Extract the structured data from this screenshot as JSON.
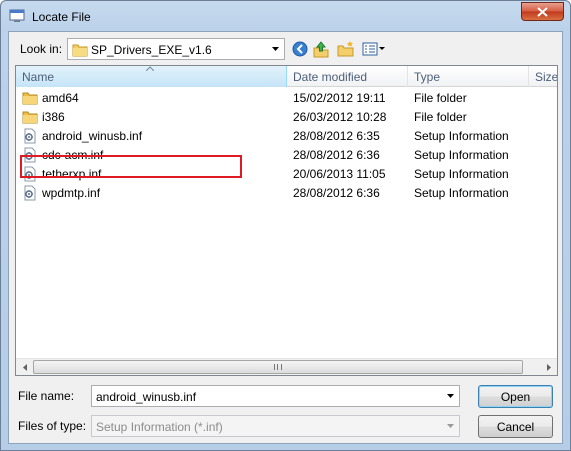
{
  "window": {
    "title": "Locate File"
  },
  "lookin": {
    "label": "Look in:",
    "value": "SP_Drivers_EXE_v1.6"
  },
  "columns": {
    "name": "Name",
    "date": "Date modified",
    "type": "Type",
    "size": "Size"
  },
  "files": [
    {
      "name": "amd64",
      "date": "15/02/2012 19:11",
      "type": "File folder",
      "icon": "folder-icon"
    },
    {
      "name": "i386",
      "date": "26/03/2012 10:28",
      "type": "File folder",
      "icon": "folder-icon"
    },
    {
      "name": "android_winusb.inf",
      "date": "28/08/2012 6:35",
      "type": "Setup Information",
      "icon": "setup-file-icon"
    },
    {
      "name": "cdc-acm.inf",
      "date": "28/08/2012 6:36",
      "type": "Setup Information",
      "icon": "setup-file-icon"
    },
    {
      "name": "tetherxp.inf",
      "date": "20/06/2013 11:05",
      "type": "Setup Information",
      "icon": "setup-file-icon"
    },
    {
      "name": "wpdmtp.inf",
      "date": "28/08/2012 6:36",
      "type": "Setup Information",
      "icon": "setup-file-icon"
    }
  ],
  "filename": {
    "label": "File name:",
    "value": "android_winusb.inf"
  },
  "filetype": {
    "label": "Files of type:",
    "value": "Setup Information (*.inf)"
  },
  "buttons": {
    "open": "Open",
    "cancel": "Cancel"
  },
  "colors": {
    "highlight": "#e01a22",
    "accent": "#3c7fb1"
  }
}
